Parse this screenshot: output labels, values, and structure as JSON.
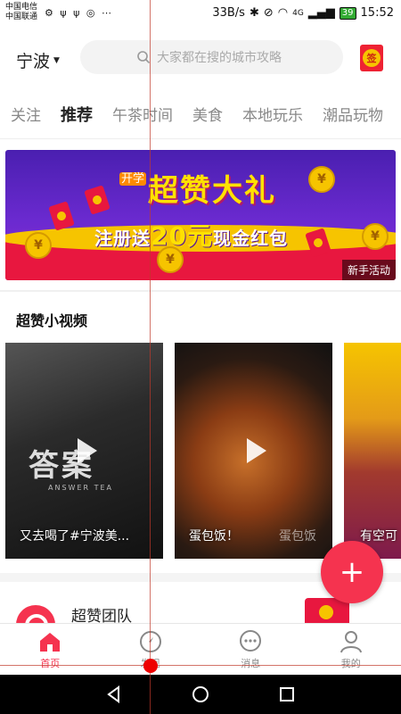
{
  "status_bar": {
    "carrier1": "中国电信",
    "carrier2": "中国联通",
    "speed": "33B/s",
    "network": "4G",
    "battery": "39",
    "time": "15:52"
  },
  "header": {
    "city": "宁波",
    "search_placeholder": "大家都在搜的城市攻略"
  },
  "tabs": [
    {
      "label": "关注"
    },
    {
      "label": "推荐"
    },
    {
      "label": "午茶时间"
    },
    {
      "label": "美食"
    },
    {
      "label": "本地玩乐"
    },
    {
      "label": "潮品玩物"
    }
  ],
  "banner": {
    "pre_title": "开学",
    "title": "超赞大礼",
    "sub_prefix": "注册送",
    "sub_amount": "20元",
    "sub_suffix": "现金红包",
    "tag": "新手活动"
  },
  "section": {
    "title": "超赞小视频"
  },
  "videos": [
    {
      "caption": "又去喝了#宁波美..."
    },
    {
      "caption": "蛋包饭！",
      "watermark": "蛋包饭"
    },
    {
      "caption": "有空可"
    }
  ],
  "fab": {
    "label": "+"
  },
  "team": {
    "name": "超赞团队"
  },
  "bottom_nav": [
    {
      "label": "首页"
    },
    {
      "label": "发现"
    },
    {
      "label": "消息"
    },
    {
      "label": "我的"
    }
  ],
  "colors": {
    "accent": "#f5334f",
    "banner_purple": "#6b2ad0",
    "banner_yellow": "#ffe100"
  }
}
